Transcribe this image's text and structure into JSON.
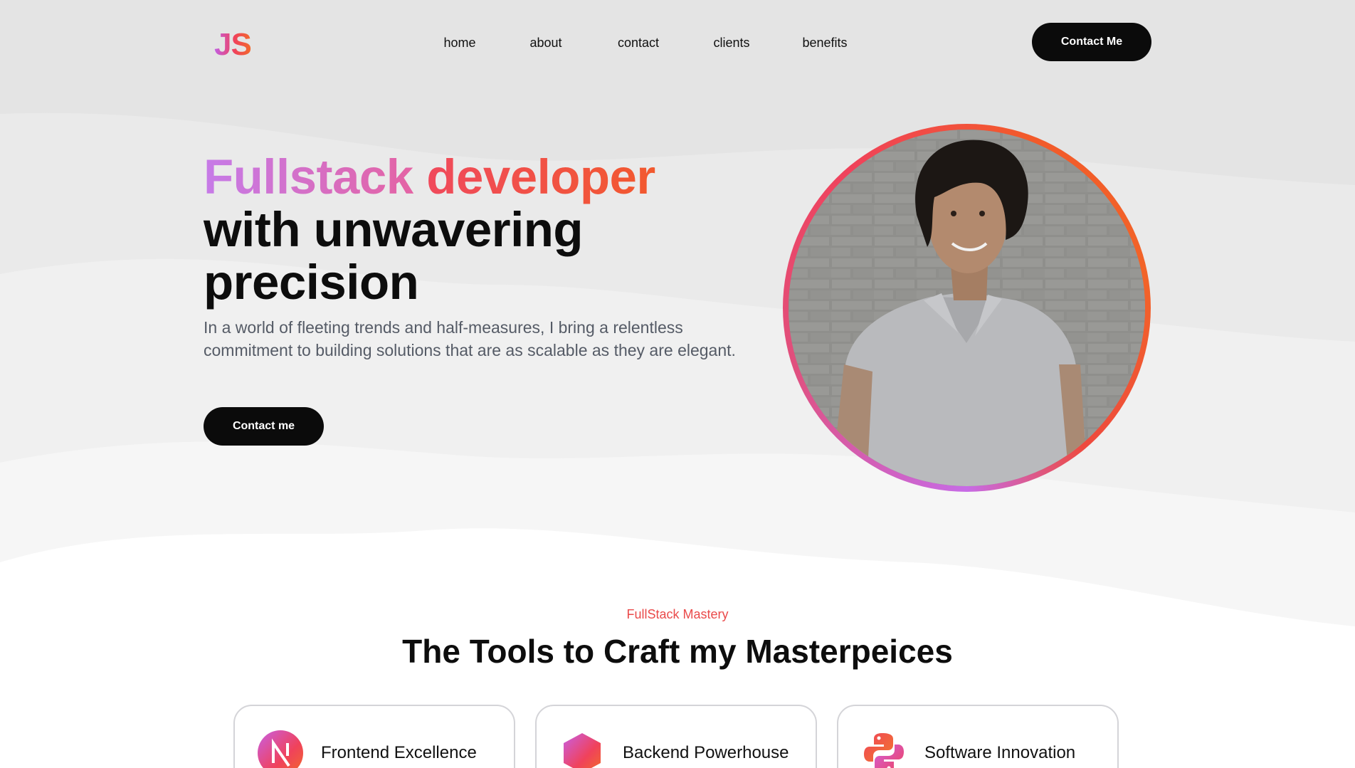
{
  "header": {
    "logo": "JS",
    "nav": [
      {
        "label": "home"
      },
      {
        "label": "about"
      },
      {
        "label": "contact"
      },
      {
        "label": "clients"
      },
      {
        "label": "benefits"
      }
    ],
    "cta_label": "Contact Me"
  },
  "hero": {
    "title_part1": "Fullstack",
    "title_part2": "developer",
    "title_line2": "with unwavering",
    "title_line3": "precision",
    "description": "In a world of fleeting trends and half-measures, I bring a relentless commitment to building solutions that are as scalable as they are elegant.",
    "cta_label": "Contact me"
  },
  "tools": {
    "eyebrow": "FullStack Mastery",
    "title": "The Tools to Craft my Masterpeices",
    "cards": [
      {
        "label": "Frontend Excellence",
        "icon": "nextjs-icon"
      },
      {
        "label": "Backend Powerhouse",
        "icon": "nodejs-icon"
      },
      {
        "label": "Software Innovation",
        "icon": "python-icon"
      }
    ]
  },
  "colors": {
    "gradient_start": "#c67be8",
    "gradient_mid": "#f04a5c",
    "gradient_end": "#f2592e",
    "button_bg": "#0b0b0b",
    "eyebrow": "#ea4a4a"
  }
}
